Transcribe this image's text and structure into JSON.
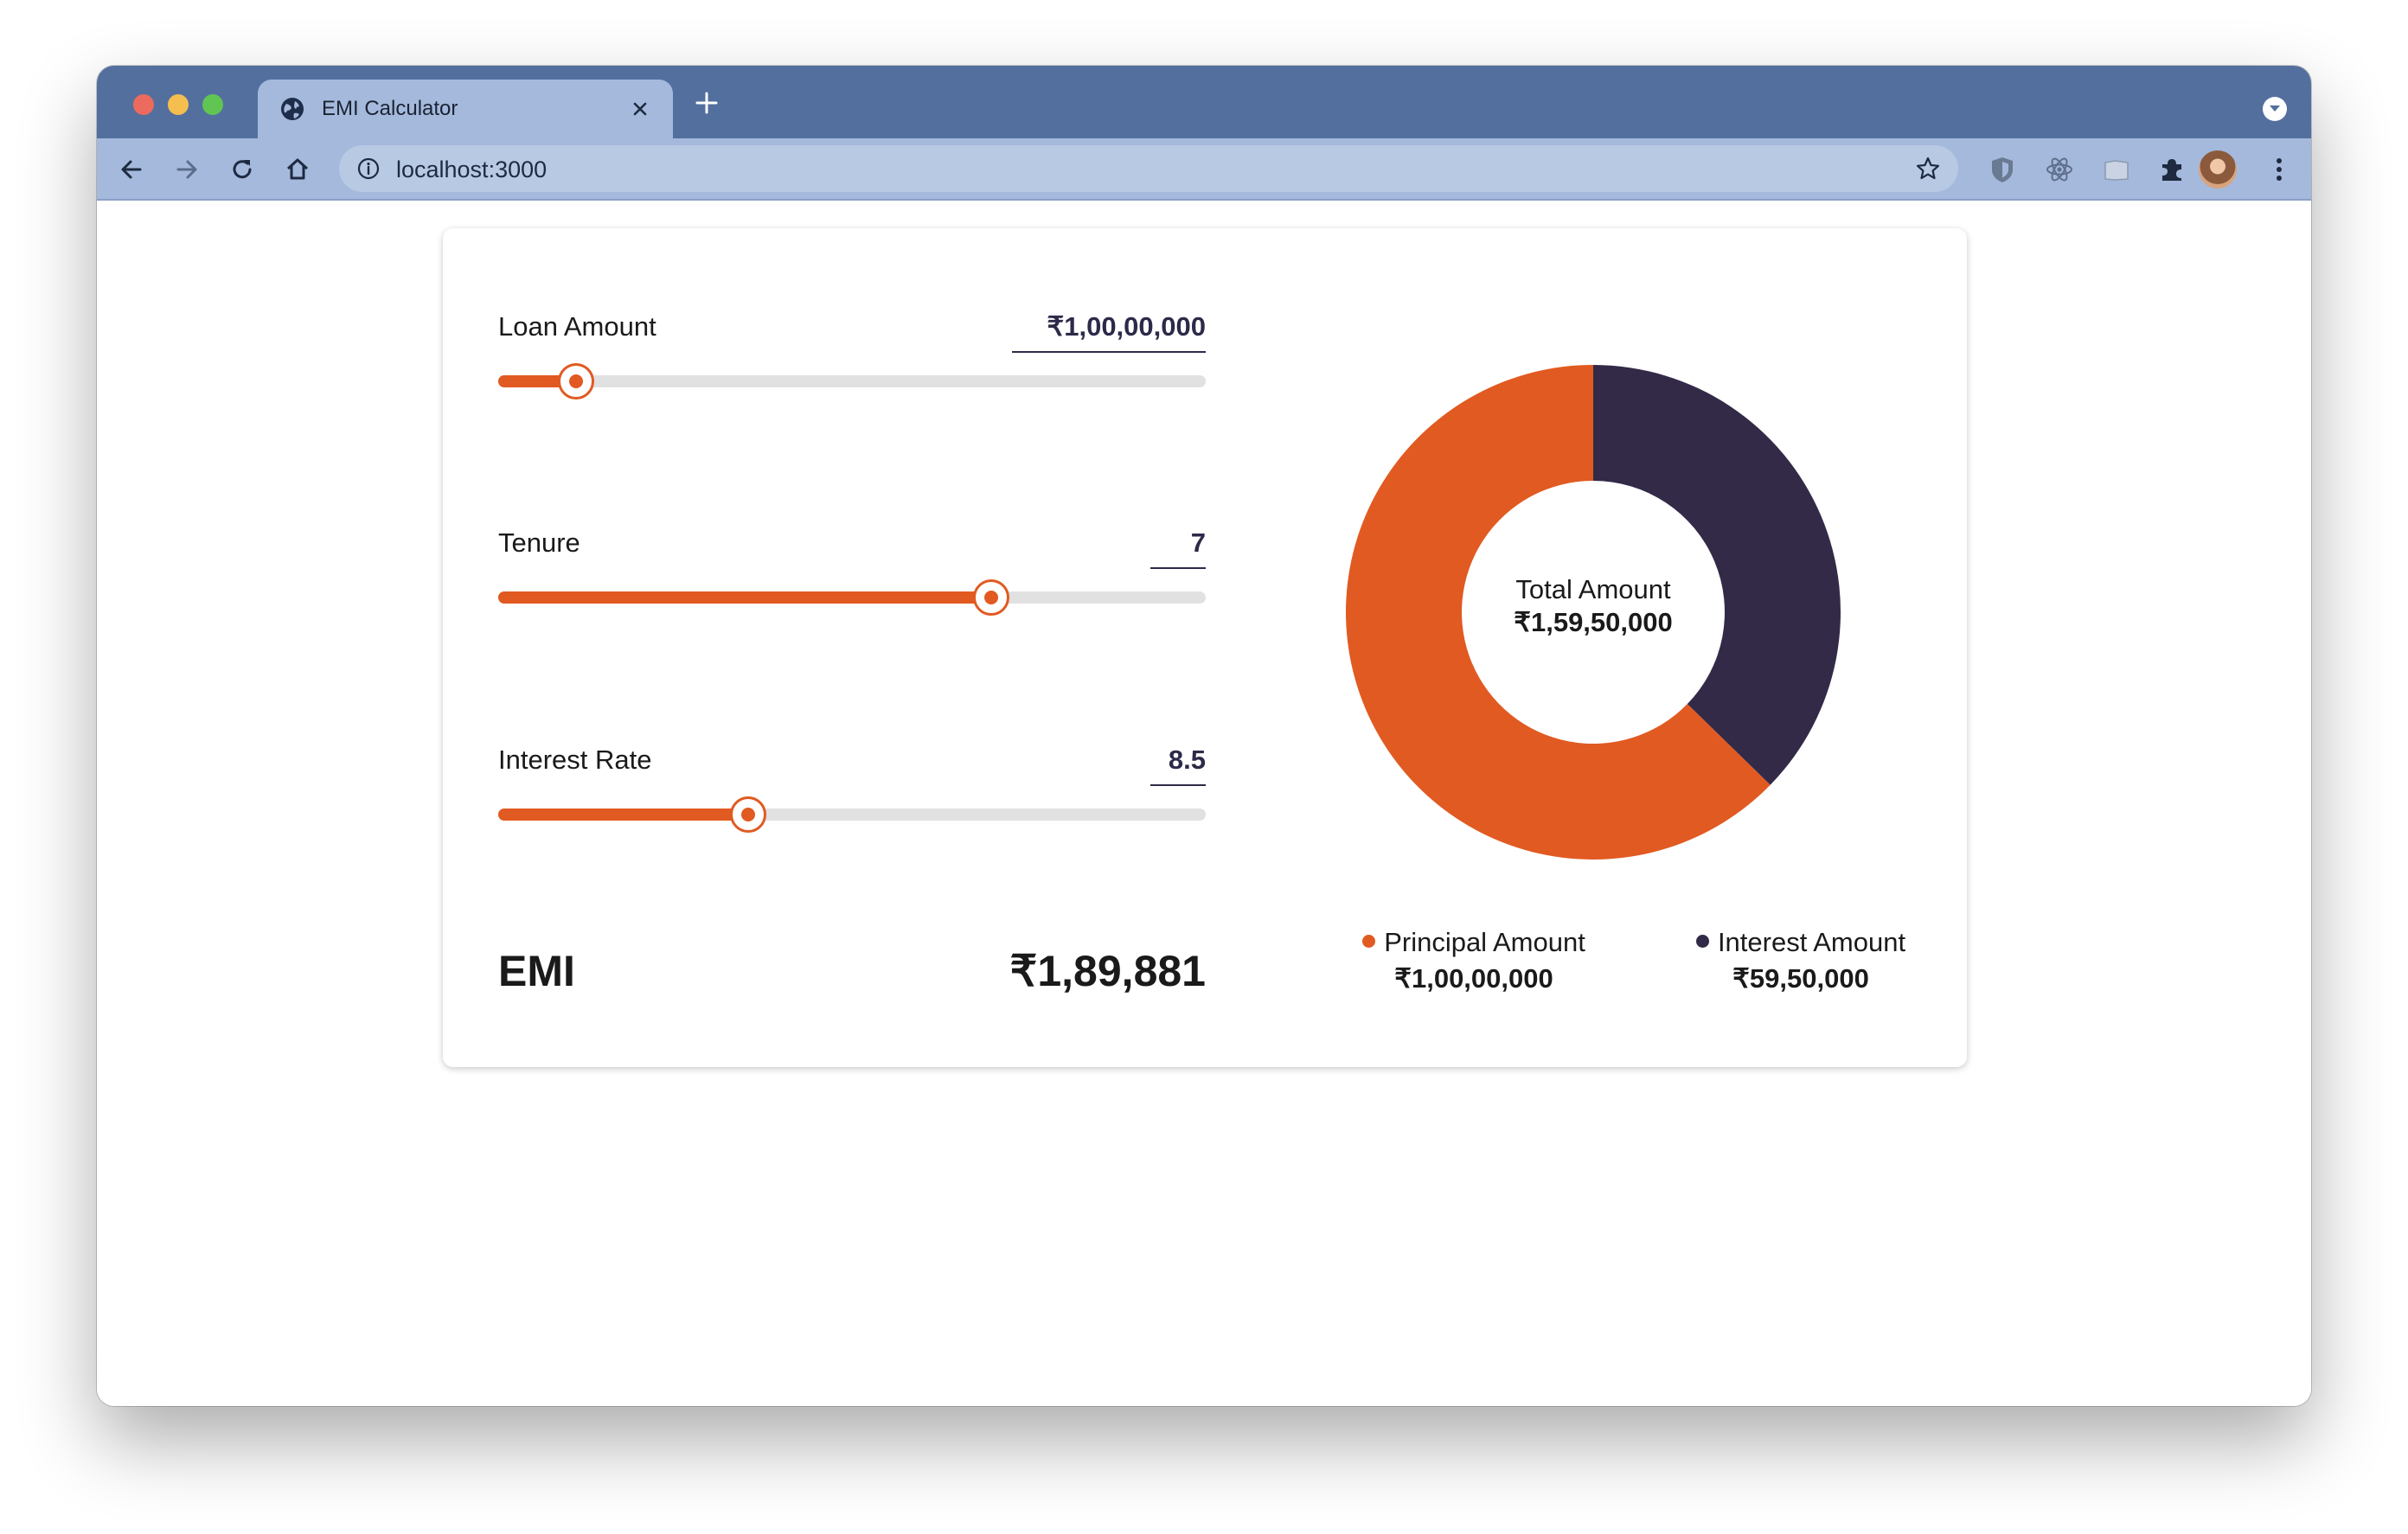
{
  "browser": {
    "tab_title": "EMI Calculator",
    "url": "localhost:3000"
  },
  "colors": {
    "principal": "#e15a21",
    "interest": "#332a48",
    "track": "#e1e1e1"
  },
  "form": {
    "loan_amount": {
      "label": "Loan Amount",
      "value": "₹1,00,00,000",
      "fill_fraction": 0.11
    },
    "tenure": {
      "label": "Tenure",
      "value": "7",
      "fill_fraction": 0.697
    },
    "interest_rate": {
      "label": "Interest Rate",
      "value": "8.5",
      "fill_fraction": 0.353
    }
  },
  "emi": {
    "label": "EMI",
    "value": "₹1,89,881"
  },
  "chart_data": {
    "type": "pie",
    "donut": true,
    "center_label": "Total Amount",
    "center_value": "₹1,59,50,000",
    "series": [
      {
        "name": "Principal Amount",
        "display": "₹1,00,00,000",
        "value": 10000000,
        "color": "#e15a21"
      },
      {
        "name": "Interest Amount",
        "display": "₹59,50,000",
        "value": 5950000,
        "color": "#332a48"
      }
    ],
    "legend": "bottom"
  }
}
